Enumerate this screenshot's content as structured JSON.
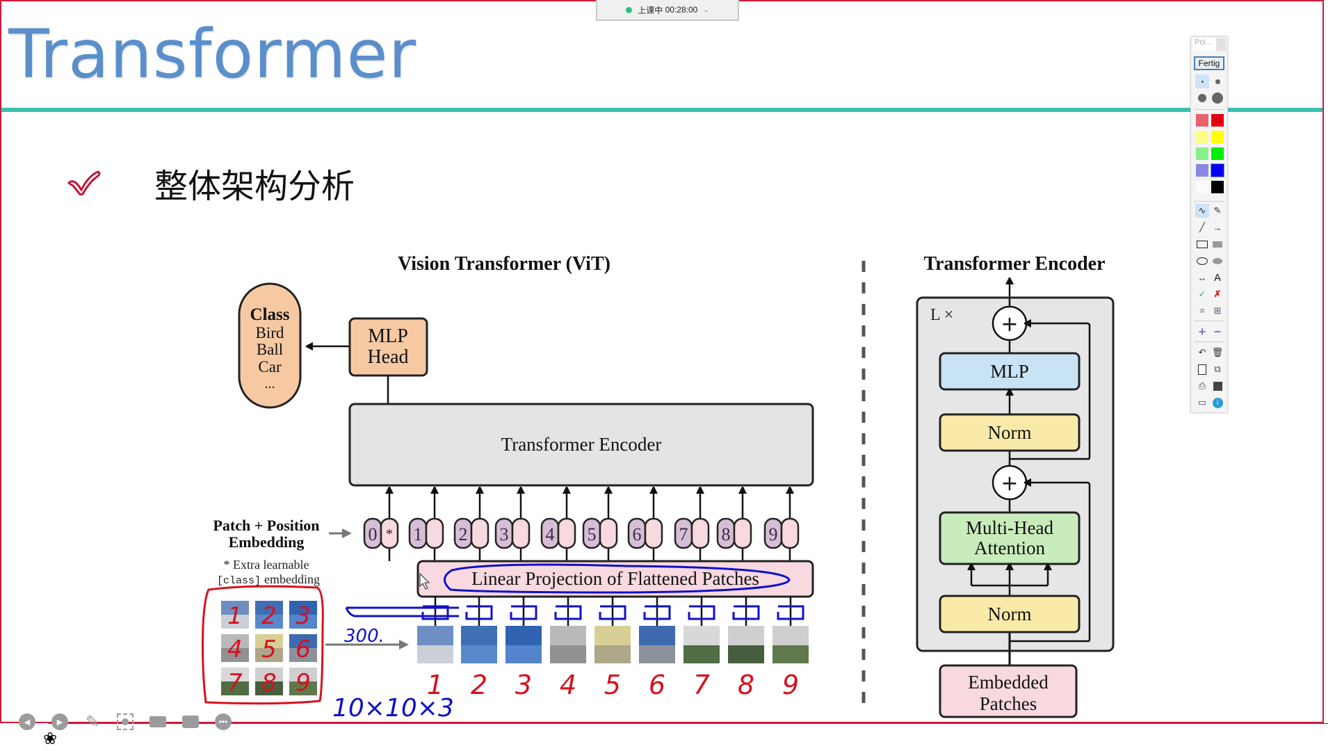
{
  "recording": {
    "status": "上课中",
    "timer": "00:28:00",
    "indicator_color": "#2ec27e"
  },
  "slide": {
    "title": "Transformer",
    "title_color": "#5b8fcb",
    "rule_color": "#3bbfae",
    "bullet_text": "整体架构分析"
  },
  "vit": {
    "title": "Vision Transformer (ViT)",
    "class_box": {
      "heading": "Class",
      "items": [
        "Bird",
        "Ball",
        "Car",
        "..."
      ]
    },
    "mlp_head": [
      "MLP",
      "Head"
    ],
    "encoder_label": "Transformer Encoder",
    "embedding_label": [
      "Patch + Position",
      "Embedding"
    ],
    "extra_note": [
      "* Extra learnable",
      "[class]",
      " embedding"
    ],
    "tokens": [
      {
        "pos": "0",
        "emb": "*"
      },
      {
        "pos": "1",
        "emb": ""
      },
      {
        "pos": "2",
        "emb": ""
      },
      {
        "pos": "3",
        "emb": ""
      },
      {
        "pos": "4",
        "emb": ""
      },
      {
        "pos": "5",
        "emb": ""
      },
      {
        "pos": "6",
        "emb": ""
      },
      {
        "pos": "7",
        "emb": ""
      },
      {
        "pos": "8",
        "emb": ""
      },
      {
        "pos": "9",
        "emb": ""
      }
    ],
    "projection_label": "Linear Projection of Flattened Patches"
  },
  "encoder_detail": {
    "title": "Transformer Encoder",
    "repeat_label": "L ×",
    "blocks": {
      "mlp": "MLP",
      "norm_top": "Norm",
      "attention": [
        "Multi-Head",
        "Attention"
      ],
      "norm_bottom": "Norm",
      "input": [
        "Embedded",
        "Patches"
      ]
    },
    "add_symbol": "+"
  },
  "annotations": {
    "grid_numbers": [
      "1",
      "2",
      "3",
      "4",
      "5",
      "6",
      "7",
      "8",
      "9"
    ],
    "sequence_numbers": [
      "1",
      "2",
      "3",
      "4",
      "5",
      "6",
      "7",
      "8",
      "9"
    ],
    "flatten_note": "300.",
    "patch_size_note": "10×10×3",
    "ink_red": "#d8101e",
    "ink_blue": "#1010c8"
  },
  "pen_toolbar": {
    "header": "Poi...",
    "done_label": "Fertig",
    "colors": [
      "#e53040",
      "#e00010",
      "#ffff66",
      "#ffff00",
      "#66ee66",
      "#00ee00",
      "#6666dd",
      "#0000ee",
      "#ffffff",
      "#000000"
    ]
  }
}
